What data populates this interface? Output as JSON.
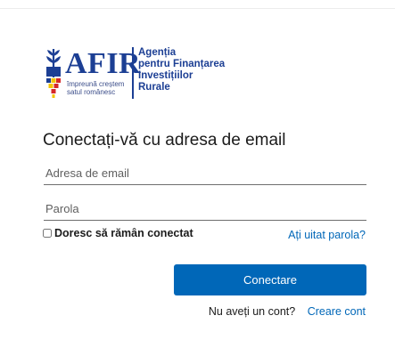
{
  "logo": {
    "wordmark": "AFIR",
    "tagline_line1": "împreună creștem",
    "tagline_line2": "satul românesc",
    "agency_line1": "Agenția",
    "agency_line2": "pentru Finanțarea",
    "agency_line3": "Investițiilor",
    "agency_line4": "Rurale",
    "brand_color": "#1c3f94"
  },
  "form": {
    "title": "Conectați-vă cu adresa de email",
    "email_placeholder": "Adresa de email",
    "email_value": "",
    "password_placeholder": "Parola",
    "password_value": "",
    "remember_label": "Doresc să rămân conectat",
    "remember_checked": false,
    "forgot_link": "Ați uitat parola?",
    "submit_label": "Conectare",
    "signup_question": "Nu aveți un cont?",
    "signup_link": "Creare cont"
  },
  "colors": {
    "accent": "#0067b8",
    "text": "#1b1b1b"
  }
}
